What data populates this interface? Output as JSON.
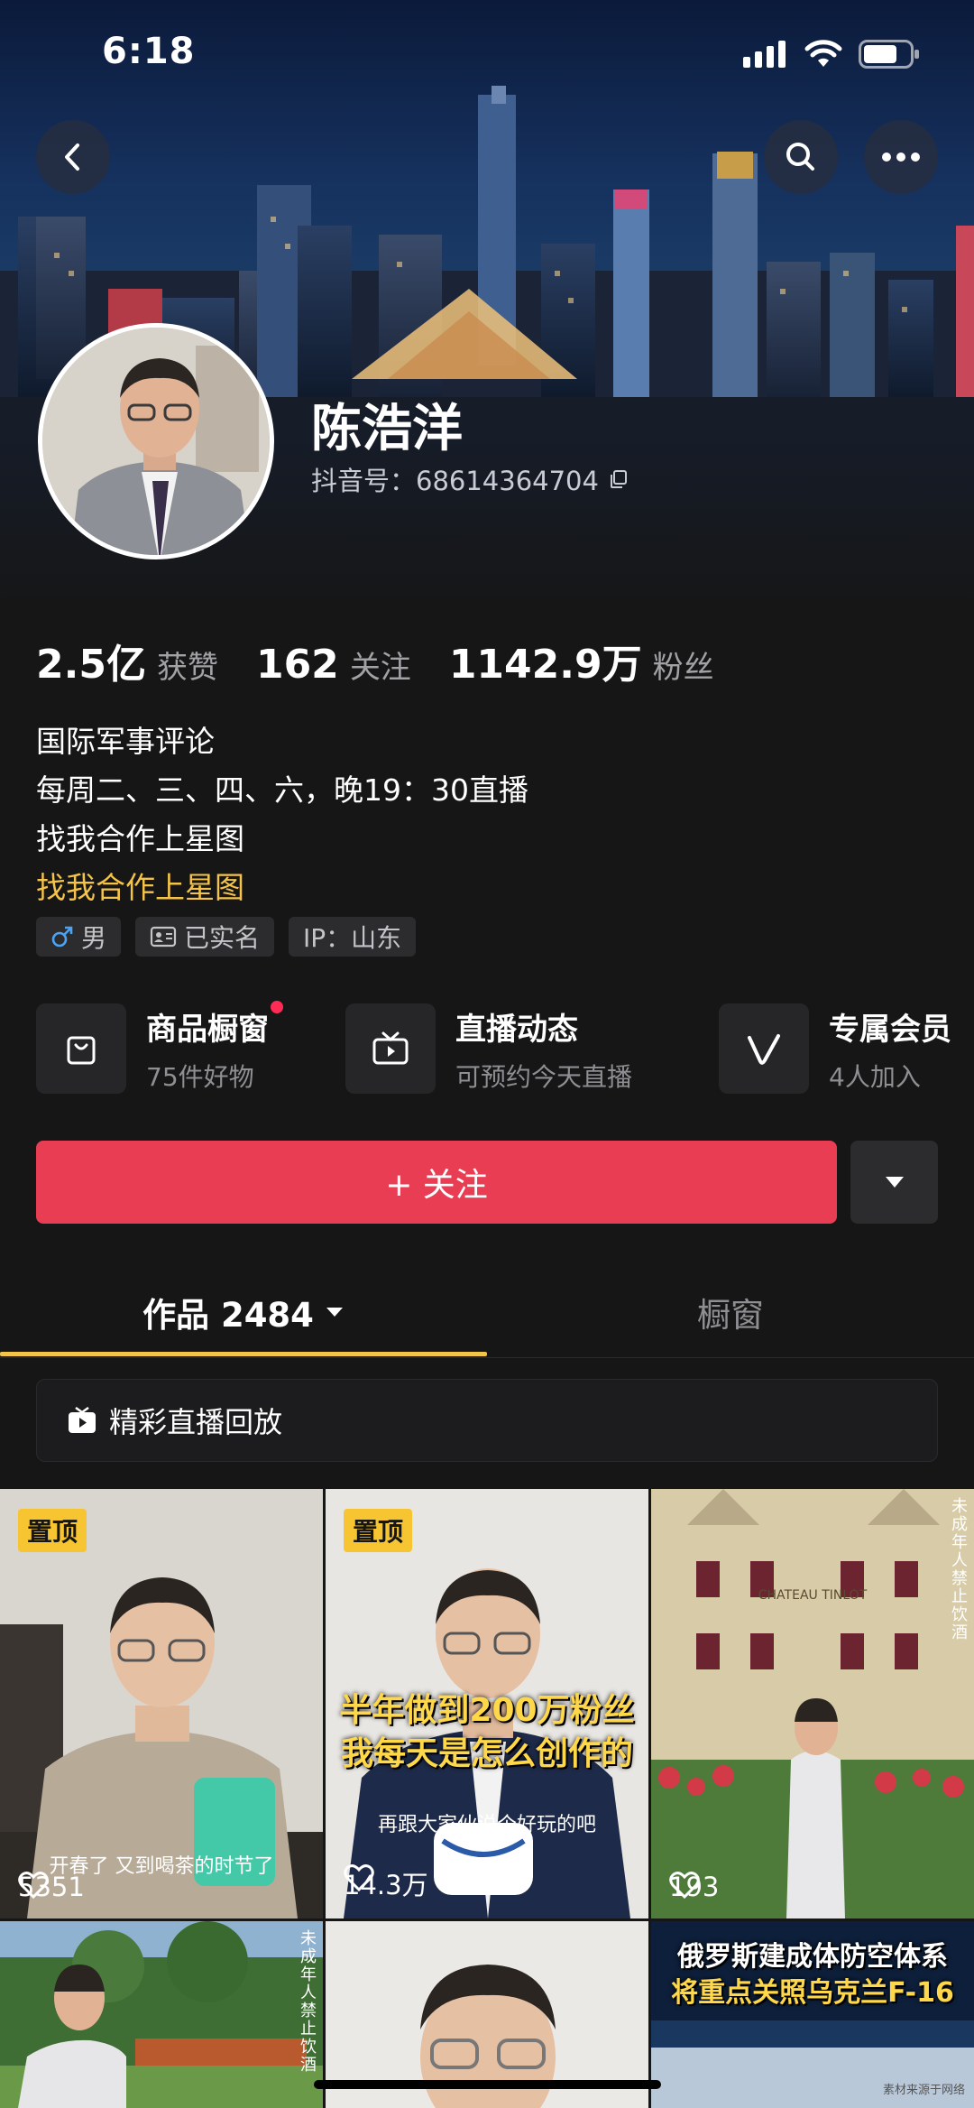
{
  "status_bar": {
    "time": "6:18"
  },
  "profile": {
    "nickname": "陈浩洋",
    "douyin_id": "抖音号：68614364704"
  },
  "stats": [
    {
      "value": "2.5亿",
      "label": "获赞"
    },
    {
      "value": "162",
      "label": "关注"
    },
    {
      "value": "1142.9万",
      "label": "粉丝"
    }
  ],
  "bio": {
    "line1": "国际军事评论",
    "line2": "每周二、三、四、六，晚19：30直播",
    "line3": "找我合作上星图",
    "line4": "找我合作上星图"
  },
  "tags": {
    "gender": "男",
    "verified": "已实名",
    "ip": "IP：山东"
  },
  "features": [
    {
      "title": "商品橱窗",
      "subtitle": "75件好物",
      "icon": "shopping-bag-icon"
    },
    {
      "title": "直播动态",
      "subtitle": "可预约今天直播",
      "icon": "tv-icon"
    },
    {
      "title": "专属会员",
      "subtitle": "4人加入",
      "icon": "v-member-icon"
    }
  ],
  "follow_button": {
    "label": "+ 关注"
  },
  "tabs": {
    "works": "作品 2484",
    "shop": "橱窗"
  },
  "replay": {
    "label": "精彩直播回放"
  },
  "videos": [
    {
      "pinned": "置顶",
      "likes": "5351",
      "caption": "开春了 又到喝茶的时节了"
    },
    {
      "pinned": "置顶",
      "likes": "14.3万",
      "caption_big_1": "半年做到200万粉丝",
      "caption_big_2": "我每天是怎么创作的",
      "caption": "再跟大家伙说个好玩的吧"
    },
    {
      "likes": "193",
      "side": "未成年人禁止饮酒",
      "sign": "CHATEAU TINLOT"
    },
    {
      "side": "未成年人禁止饮酒"
    },
    {},
    {
      "caption_big_1": "俄罗斯建成体防空体系",
      "caption_big_2": "将重点关照乌克兰F-16",
      "watermark": "素材来源于网络"
    }
  ],
  "colors": {
    "accent_red": "#e93d54",
    "accent_yellow": "#f4c34a",
    "pin_yellow": "#f7c531"
  }
}
